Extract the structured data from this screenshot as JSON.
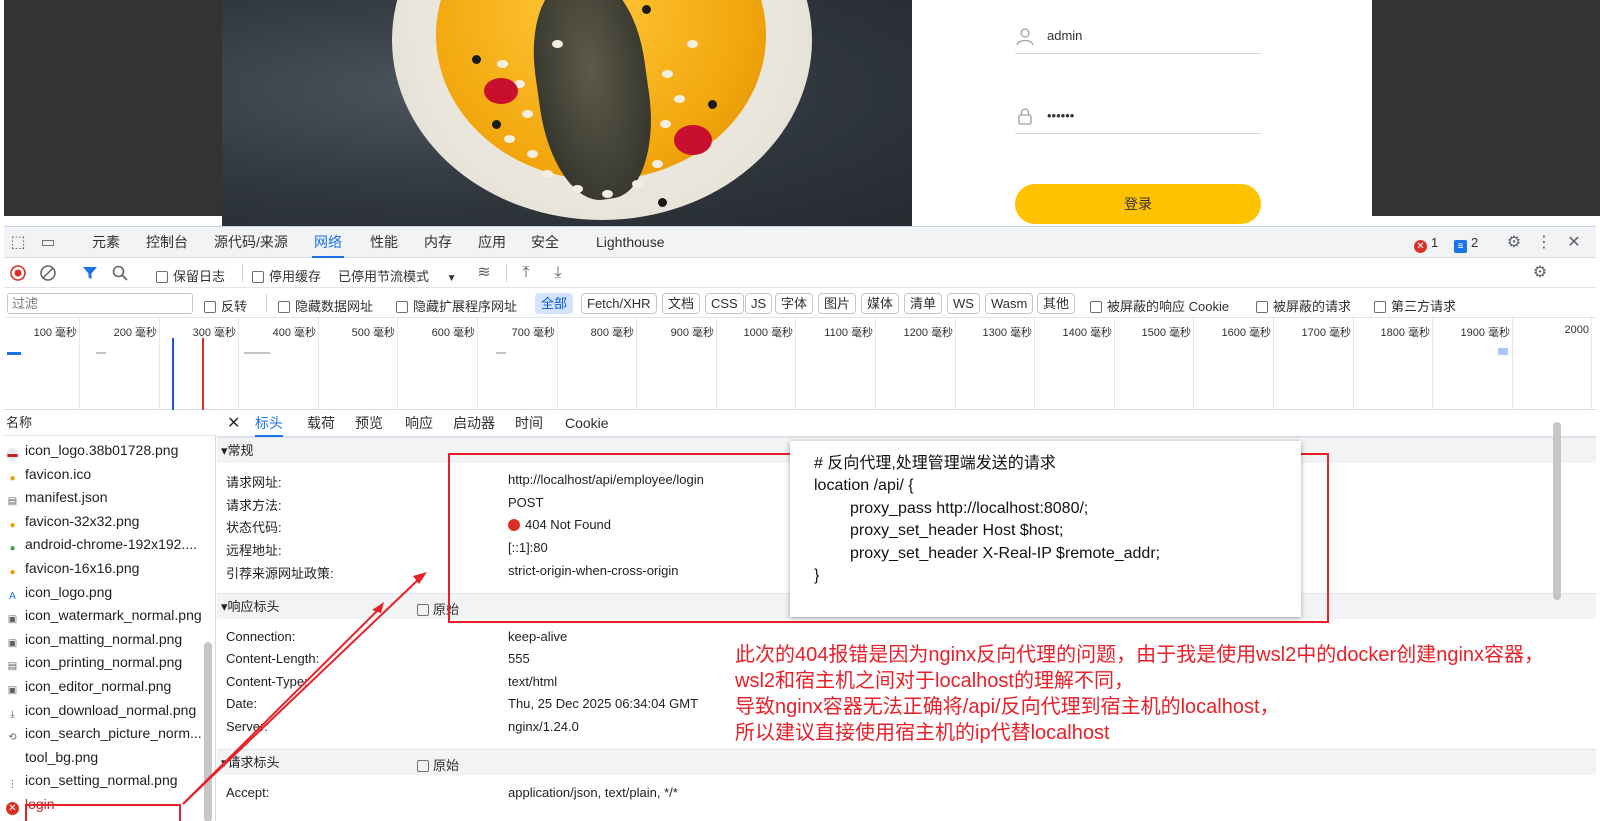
{
  "login": {
    "username": "admin",
    "password_mask": "••••••",
    "submit_label": "登录"
  },
  "devtools": {
    "tabs": [
      "元素",
      "控制台",
      "源代码/来源",
      "网络",
      "性能",
      "内存",
      "应用",
      "安全",
      "Lighthouse"
    ],
    "active_tab": "网络",
    "error_count": "1",
    "message_count": "2",
    "toolbar": {
      "preserve_log": "保留日志",
      "disable_cache": "停用缓存",
      "throttling": "已停用节流模式"
    },
    "filter": {
      "placeholder": "过滤",
      "invert": "反转",
      "hide_data_urls": "隐藏数据网址",
      "hide_extension_urls": "隐藏扩展程序网址",
      "types": [
        "全部",
        "Fetch/XHR",
        "文档",
        "CSS",
        "JS",
        "字体",
        "图片",
        "媒体",
        "清单",
        "WS",
        "Wasm",
        "其他"
      ],
      "blocked_cookies": "被屏蔽的响应 Cookie",
      "blocked_requests": "被屏蔽的请求",
      "third_party": "第三方请求"
    },
    "timeline_ticks": [
      "100 毫秒",
      "200 毫秒",
      "300 毫秒",
      "400 毫秒",
      "500 毫秒",
      "600 毫秒",
      "700 毫秒",
      "800 毫秒",
      "900 毫秒",
      "1000 毫秒",
      "1100 毫秒",
      "1200 毫秒",
      "1300 毫秒",
      "1400 毫秒",
      "1500 毫秒",
      "1600 毫秒",
      "1700 毫秒",
      "1800 毫秒",
      "1900 毫秒",
      "2000"
    ],
    "request_list": {
      "header": "名称",
      "items": [
        "icon_logo.38b01728.png",
        "favicon.ico",
        "manifest.json",
        "favicon-32x32.png",
        "android-chrome-192x192....",
        "favicon-16x16.png",
        "icon_logo.png",
        "icon_watermark_normal.png",
        "icon_matting_normal.png",
        "icon_printing_normal.png",
        "icon_editor_normal.png",
        "icon_download_normal.png",
        "icon_search_picture_norm...",
        "tool_bg.png",
        "icon_setting_normal.png",
        "login"
      ]
    },
    "detail": {
      "tabs": [
        "标头",
        "载荷",
        "预览",
        "响应",
        "启动器",
        "时间",
        "Cookie"
      ],
      "general_title": "▾常规",
      "general": [
        {
          "k": "请求网址:",
          "v": "http://localhost/api/employee/login"
        },
        {
          "k": "请求方法:",
          "v": "POST"
        },
        {
          "k": "状态代码:",
          "v": "404 Not Found"
        },
        {
          "k": "远程地址:",
          "v": "[::1]:80"
        },
        {
          "k": "引荐来源网址政策:",
          "v": "strict-origin-when-cross-origin"
        }
      ],
      "response_title": "▾响应标头",
      "raw_label": "原始",
      "response": [
        {
          "k": "Connection:",
          "v": "keep-alive"
        },
        {
          "k": "Content-Length:",
          "v": "555"
        },
        {
          "k": "Content-Type:",
          "v": "text/html"
        },
        {
          "k": "Date:",
          "v": "Thu, 25 Dec 2025 06:34:04 GMT"
        },
        {
          "k": "Server:",
          "v": "nginx/1.24.0"
        }
      ],
      "request_title": "▾请求标头",
      "request": [
        {
          "k": "Accept:",
          "v": "application/json, text/plain, */*"
        }
      ]
    }
  },
  "annotation": {
    "code": [
      "# 反向代理,处理管理端发送的请求",
      "location /api/ {",
      "proxy_pass http://localhost:8080/;",
      "proxy_set_header Host $host;",
      "proxy_set_header X-Real-IP $remote_addr;",
      "}"
    ],
    "note": [
      "此次的404报错是因为nginx反向代理的问题，由于我是使用wsl2中的docker创建nginx容器，",
      "wsl2和宿主机之间对于localhost的理解不同，",
      "导致nginx容器无法正确将/api/反向代理到宿主机的localhost，",
      "所以建议直接使用宿主机的ip代替localhost"
    ]
  },
  "colors": {
    "accent": "#1a73e8",
    "annotation_red": "#e8202a",
    "login_button": "#ffc200",
    "error": "#d93025"
  }
}
